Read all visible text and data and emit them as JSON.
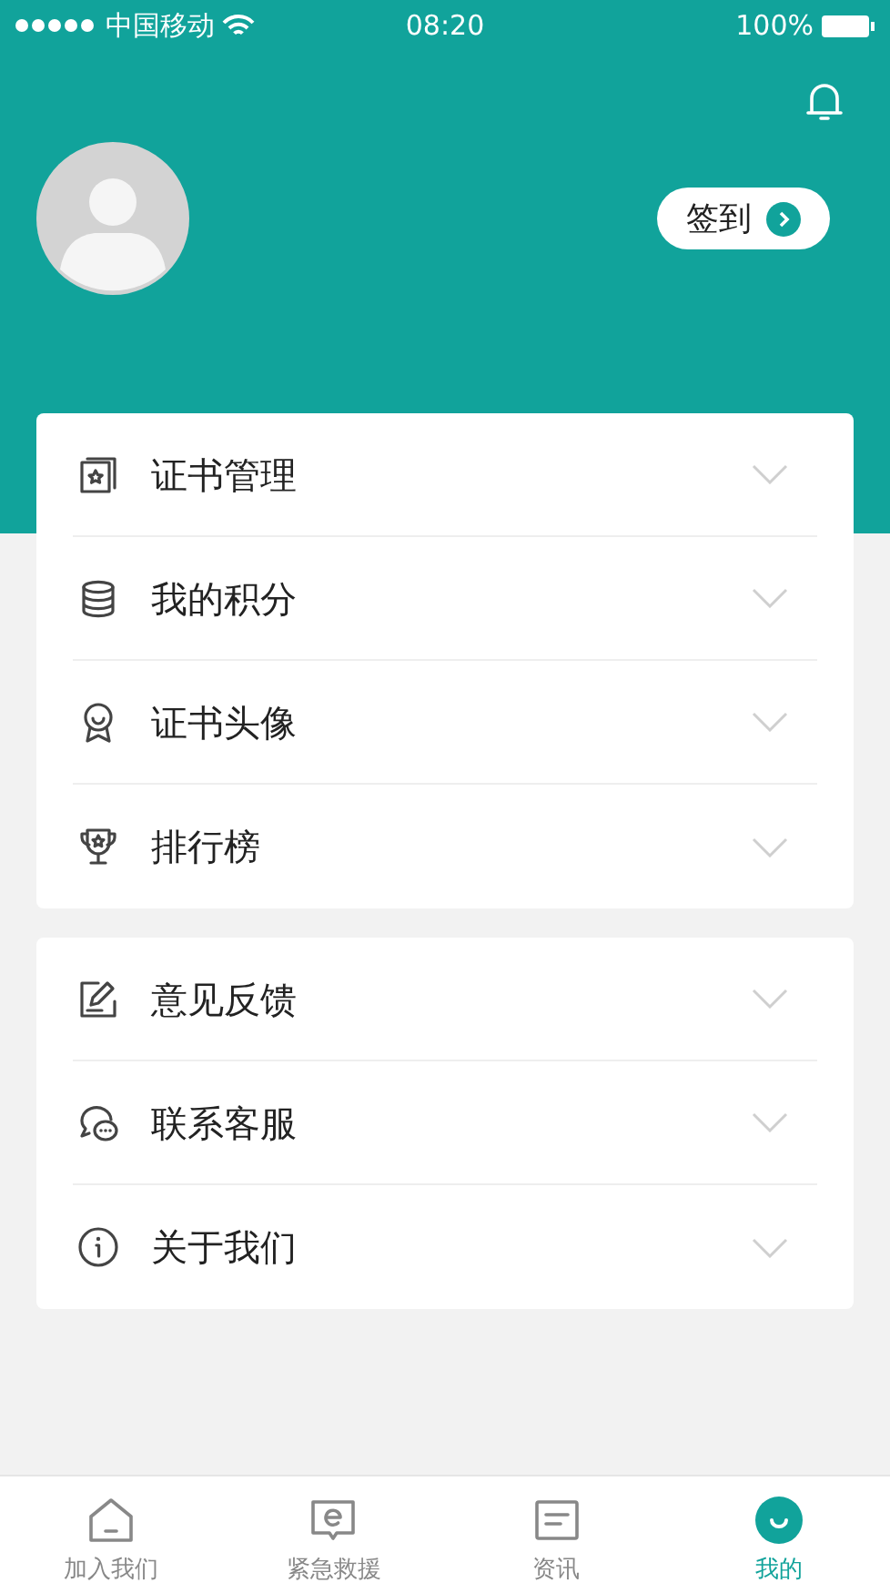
{
  "status_bar": {
    "carrier": "中国移动",
    "time": "08:20",
    "battery": "100%"
  },
  "header": {
    "sign_in": "签到"
  },
  "menu_groups": [
    {
      "items": [
        {
          "label": "证书管理",
          "kind": "certificate"
        },
        {
          "label": "我的积分",
          "kind": "points"
        },
        {
          "label": "证书头像",
          "kind": "badge"
        },
        {
          "label": "排行榜",
          "kind": "trophy"
        }
      ]
    },
    {
      "items": [
        {
          "label": "意见反馈",
          "kind": "feedback"
        },
        {
          "label": "联系客服",
          "kind": "chat"
        },
        {
          "label": "关于我们",
          "kind": "info"
        }
      ]
    }
  ],
  "tab_bar": [
    {
      "label": "加入我们",
      "kind": "home",
      "selected": false
    },
    {
      "label": "紧急救援",
      "kind": "emergency",
      "selected": false
    },
    {
      "label": "资讯",
      "kind": "news",
      "selected": false
    },
    {
      "label": "我的",
      "kind": "profile",
      "selected": true
    }
  ]
}
